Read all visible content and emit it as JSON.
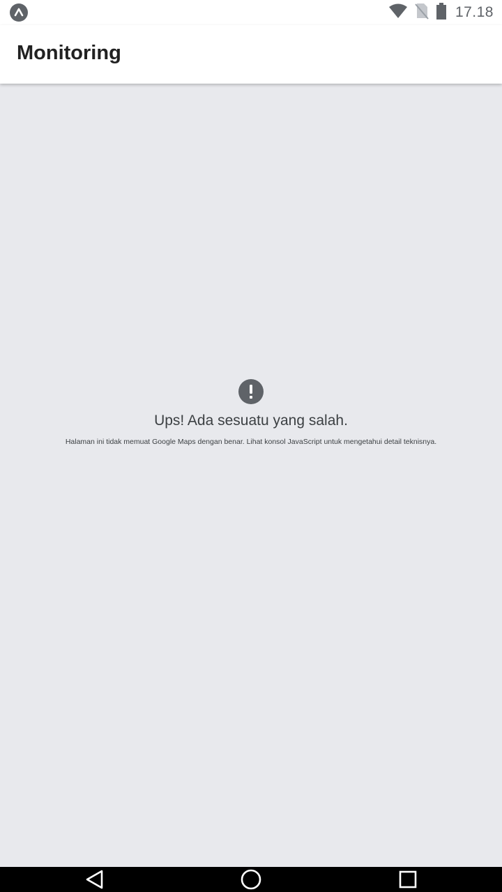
{
  "status_bar": {
    "app_icon": "app-notification-icon",
    "icons": [
      "wifi-icon",
      "no-sim-icon",
      "battery-icon"
    ],
    "time": "17.18"
  },
  "app_bar": {
    "title": "Monitoring"
  },
  "map_error": {
    "icon": "exclamation-icon",
    "title": "Ups! Ada sesuatu yang salah.",
    "message": "Halaman ini tidak memuat Google Maps dengan benar. Lihat konsol JavaScript untuk mengetahui detail teknisnya."
  },
  "nav_bar": {
    "buttons": [
      "back-icon",
      "home-icon",
      "recents-icon"
    ]
  },
  "colors": {
    "status_bar_bg": "#ffffff",
    "app_bar_bg": "#ffffff",
    "map_bg": "#e8e9ed",
    "nav_bar_bg": "#000000",
    "icon_gray": "#5f6368"
  }
}
